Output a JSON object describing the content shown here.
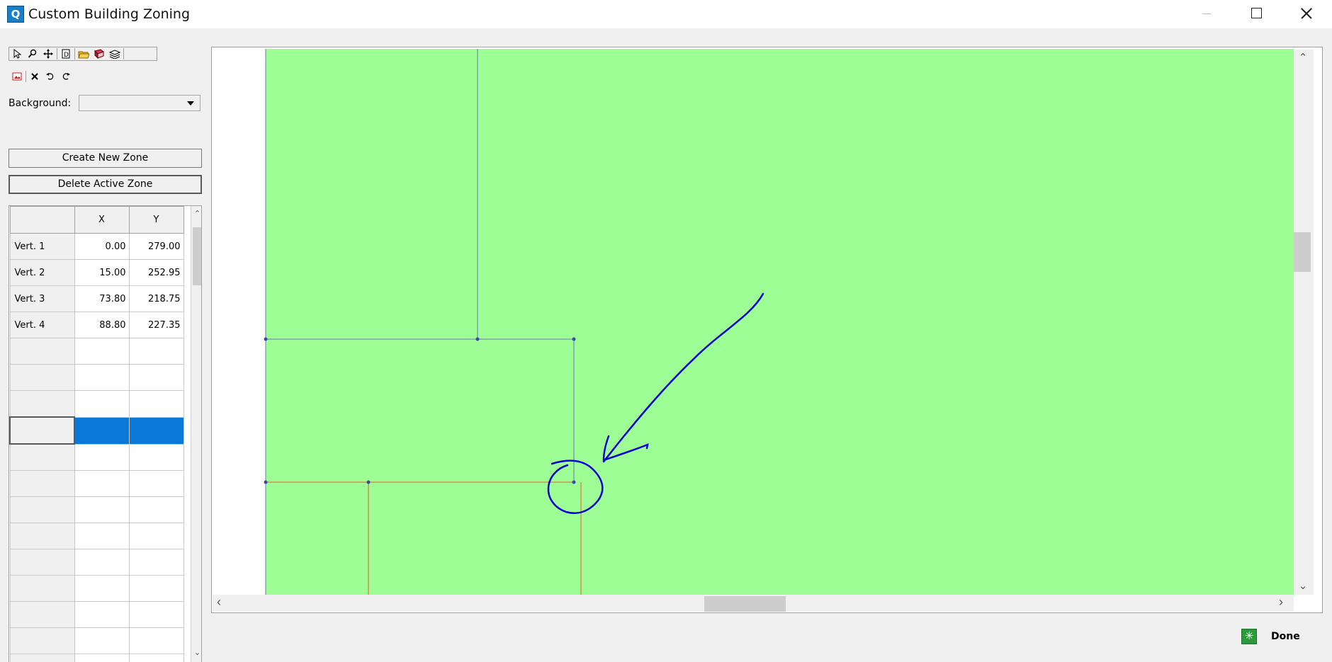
{
  "window": {
    "title": "Custom Building Zoning"
  },
  "toolbar": {
    "row1": [
      "arrow-pointer-icon",
      "zoom-icon",
      "pan-icon",
      "dimension-icon",
      "open-folder-icon",
      "book-icon",
      "layers-icon"
    ],
    "row2": [
      "image-icon",
      "delete-icon",
      "undo-icon",
      "redo-icon"
    ]
  },
  "background": {
    "label": "Background:",
    "value": ""
  },
  "buttons": {
    "create": "Create New Zone",
    "delete": "Delete Active Zone",
    "done": "Done"
  },
  "grid": {
    "headers": [
      "X",
      "Y"
    ],
    "rows": [
      {
        "label": "Vert. 1",
        "x": "0.00",
        "y": "279.00"
      },
      {
        "label": "Vert. 2",
        "x": "15.00",
        "y": "252.95"
      },
      {
        "label": "Vert. 3",
        "x": "73.80",
        "y": "218.75"
      },
      {
        "label": "Vert. 4",
        "x": "88.80",
        "y": "227.35"
      }
    ],
    "empty_rows": 13,
    "selected_row_index": 7
  },
  "colors": {
    "canvas_fill": "#9dfe96",
    "zone_line_blue": "#6a7bb0",
    "zone_line_orange": "#d9803f",
    "annotation": "#0000d8",
    "selection": "#0a78d7"
  }
}
